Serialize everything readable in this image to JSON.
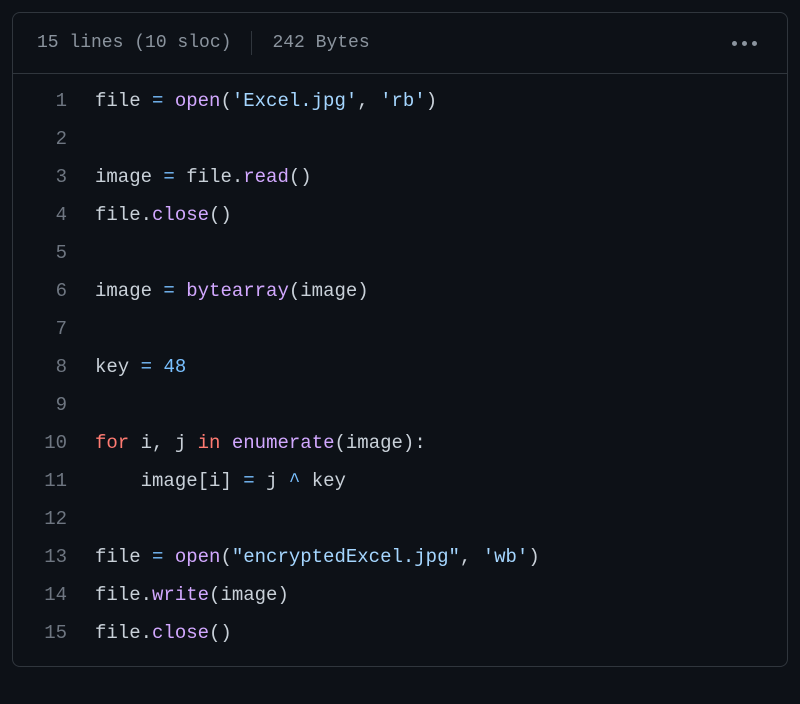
{
  "header": {
    "lines_label": "15 lines (10 sloc)",
    "bytes_label": "242 Bytes"
  },
  "code": {
    "lines": [
      {
        "n": 1,
        "tokens": [
          {
            "t": "file",
            "c": "var"
          },
          {
            "t": " ",
            "c": "var"
          },
          {
            "t": "=",
            "c": "op"
          },
          {
            "t": " ",
            "c": "var"
          },
          {
            "t": "open",
            "c": "func"
          },
          {
            "t": "(",
            "c": "punct"
          },
          {
            "t": "'Excel.jpg'",
            "c": "str"
          },
          {
            "t": ", ",
            "c": "punct"
          },
          {
            "t": "'rb'",
            "c": "str"
          },
          {
            "t": ")",
            "c": "punct"
          }
        ]
      },
      {
        "n": 2,
        "tokens": []
      },
      {
        "n": 3,
        "tokens": [
          {
            "t": "image",
            "c": "var"
          },
          {
            "t": " ",
            "c": "var"
          },
          {
            "t": "=",
            "c": "op"
          },
          {
            "t": " ",
            "c": "var"
          },
          {
            "t": "file",
            "c": "var"
          },
          {
            "t": ".",
            "c": "punct"
          },
          {
            "t": "read",
            "c": "func"
          },
          {
            "t": "()",
            "c": "punct"
          }
        ]
      },
      {
        "n": 4,
        "tokens": [
          {
            "t": "file",
            "c": "var"
          },
          {
            "t": ".",
            "c": "punct"
          },
          {
            "t": "close",
            "c": "func"
          },
          {
            "t": "()",
            "c": "punct"
          }
        ]
      },
      {
        "n": 5,
        "tokens": []
      },
      {
        "n": 6,
        "tokens": [
          {
            "t": "image",
            "c": "var"
          },
          {
            "t": " ",
            "c": "var"
          },
          {
            "t": "=",
            "c": "op"
          },
          {
            "t": " ",
            "c": "var"
          },
          {
            "t": "bytearray",
            "c": "func"
          },
          {
            "t": "(",
            "c": "punct"
          },
          {
            "t": "image",
            "c": "var"
          },
          {
            "t": ")",
            "c": "punct"
          }
        ]
      },
      {
        "n": 7,
        "tokens": []
      },
      {
        "n": 8,
        "tokens": [
          {
            "t": "key",
            "c": "var"
          },
          {
            "t": " ",
            "c": "var"
          },
          {
            "t": "=",
            "c": "op"
          },
          {
            "t": " ",
            "c": "var"
          },
          {
            "t": "48",
            "c": "num"
          }
        ]
      },
      {
        "n": 9,
        "tokens": []
      },
      {
        "n": 10,
        "tokens": [
          {
            "t": "for",
            "c": "kw"
          },
          {
            "t": " ",
            "c": "var"
          },
          {
            "t": "i",
            "c": "var"
          },
          {
            "t": ", ",
            "c": "punct"
          },
          {
            "t": "j",
            "c": "var"
          },
          {
            "t": " ",
            "c": "var"
          },
          {
            "t": "in",
            "c": "kw"
          },
          {
            "t": " ",
            "c": "var"
          },
          {
            "t": "enumerate",
            "c": "func"
          },
          {
            "t": "(",
            "c": "punct"
          },
          {
            "t": "image",
            "c": "var"
          },
          {
            "t": "):",
            "c": "punct"
          }
        ]
      },
      {
        "n": 11,
        "tokens": [
          {
            "t": "    ",
            "c": "var"
          },
          {
            "t": "image",
            "c": "var"
          },
          {
            "t": "[",
            "c": "punct"
          },
          {
            "t": "i",
            "c": "var"
          },
          {
            "t": "] ",
            "c": "punct"
          },
          {
            "t": "=",
            "c": "op"
          },
          {
            "t": " ",
            "c": "var"
          },
          {
            "t": "j",
            "c": "var"
          },
          {
            "t": " ",
            "c": "var"
          },
          {
            "t": "^",
            "c": "op"
          },
          {
            "t": " ",
            "c": "var"
          },
          {
            "t": "key",
            "c": "var"
          }
        ]
      },
      {
        "n": 12,
        "tokens": []
      },
      {
        "n": 13,
        "tokens": [
          {
            "t": "file",
            "c": "var"
          },
          {
            "t": " ",
            "c": "var"
          },
          {
            "t": "=",
            "c": "op"
          },
          {
            "t": " ",
            "c": "var"
          },
          {
            "t": "open",
            "c": "func"
          },
          {
            "t": "(",
            "c": "punct"
          },
          {
            "t": "\"encryptedExcel.jpg\"",
            "c": "str"
          },
          {
            "t": ", ",
            "c": "punct"
          },
          {
            "t": "'wb'",
            "c": "str"
          },
          {
            "t": ")",
            "c": "punct"
          }
        ]
      },
      {
        "n": 14,
        "tokens": [
          {
            "t": "file",
            "c": "var"
          },
          {
            "t": ".",
            "c": "punct"
          },
          {
            "t": "write",
            "c": "func"
          },
          {
            "t": "(",
            "c": "punct"
          },
          {
            "t": "image",
            "c": "var"
          },
          {
            "t": ")",
            "c": "punct"
          }
        ]
      },
      {
        "n": 15,
        "tokens": [
          {
            "t": "file",
            "c": "var"
          },
          {
            "t": ".",
            "c": "punct"
          },
          {
            "t": "close",
            "c": "func"
          },
          {
            "t": "()",
            "c": "punct"
          }
        ]
      }
    ]
  }
}
